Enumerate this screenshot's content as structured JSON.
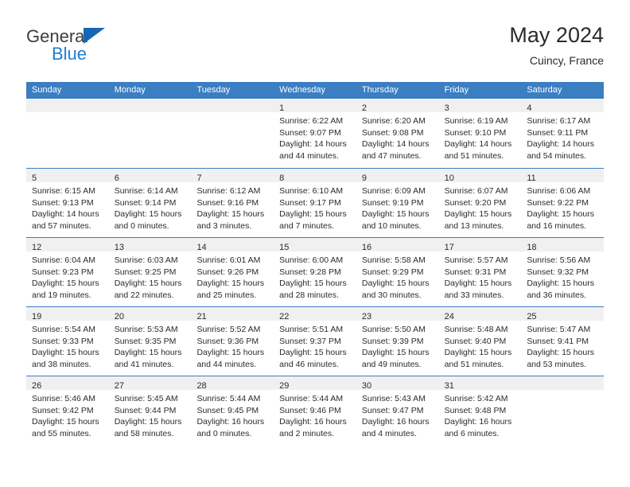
{
  "brand": {
    "name_part1": "General",
    "name_part2": "Blue",
    "triangle_icon": "triangle-logo-icon",
    "colors": {
      "dark": "#3c3c3c",
      "blue": "#1a7fd4",
      "triangle": "#1567b3"
    }
  },
  "header": {
    "title": "May 2024",
    "subtitle": "Cuincy, France"
  },
  "colors": {
    "header_band": "#3b7ec1",
    "day_band": "#f0f0f0",
    "text": "#2b2b2b",
    "rule": "#3b7ec1"
  },
  "weekdays": [
    "Sunday",
    "Monday",
    "Tuesday",
    "Wednesday",
    "Thursday",
    "Friday",
    "Saturday"
  ],
  "weeks": [
    [
      {
        "day": "",
        "lines": []
      },
      {
        "day": "",
        "lines": []
      },
      {
        "day": "",
        "lines": []
      },
      {
        "day": "1",
        "lines": [
          "Sunrise: 6:22 AM",
          "Sunset: 9:07 PM",
          "Daylight: 14 hours",
          "and 44 minutes."
        ]
      },
      {
        "day": "2",
        "lines": [
          "Sunrise: 6:20 AM",
          "Sunset: 9:08 PM",
          "Daylight: 14 hours",
          "and 47 minutes."
        ]
      },
      {
        "day": "3",
        "lines": [
          "Sunrise: 6:19 AM",
          "Sunset: 9:10 PM",
          "Daylight: 14 hours",
          "and 51 minutes."
        ]
      },
      {
        "day": "4",
        "lines": [
          "Sunrise: 6:17 AM",
          "Sunset: 9:11 PM",
          "Daylight: 14 hours",
          "and 54 minutes."
        ]
      }
    ],
    [
      {
        "day": "5",
        "lines": [
          "Sunrise: 6:15 AM",
          "Sunset: 9:13 PM",
          "Daylight: 14 hours",
          "and 57 minutes."
        ]
      },
      {
        "day": "6",
        "lines": [
          "Sunrise: 6:14 AM",
          "Sunset: 9:14 PM",
          "Daylight: 15 hours",
          "and 0 minutes."
        ]
      },
      {
        "day": "7",
        "lines": [
          "Sunrise: 6:12 AM",
          "Sunset: 9:16 PM",
          "Daylight: 15 hours",
          "and 3 minutes."
        ]
      },
      {
        "day": "8",
        "lines": [
          "Sunrise: 6:10 AM",
          "Sunset: 9:17 PM",
          "Daylight: 15 hours",
          "and 7 minutes."
        ]
      },
      {
        "day": "9",
        "lines": [
          "Sunrise: 6:09 AM",
          "Sunset: 9:19 PM",
          "Daylight: 15 hours",
          "and 10 minutes."
        ]
      },
      {
        "day": "10",
        "lines": [
          "Sunrise: 6:07 AM",
          "Sunset: 9:20 PM",
          "Daylight: 15 hours",
          "and 13 minutes."
        ]
      },
      {
        "day": "11",
        "lines": [
          "Sunrise: 6:06 AM",
          "Sunset: 9:22 PM",
          "Daylight: 15 hours",
          "and 16 minutes."
        ]
      }
    ],
    [
      {
        "day": "12",
        "lines": [
          "Sunrise: 6:04 AM",
          "Sunset: 9:23 PM",
          "Daylight: 15 hours",
          "and 19 minutes."
        ]
      },
      {
        "day": "13",
        "lines": [
          "Sunrise: 6:03 AM",
          "Sunset: 9:25 PM",
          "Daylight: 15 hours",
          "and 22 minutes."
        ]
      },
      {
        "day": "14",
        "lines": [
          "Sunrise: 6:01 AM",
          "Sunset: 9:26 PM",
          "Daylight: 15 hours",
          "and 25 minutes."
        ]
      },
      {
        "day": "15",
        "lines": [
          "Sunrise: 6:00 AM",
          "Sunset: 9:28 PM",
          "Daylight: 15 hours",
          "and 28 minutes."
        ]
      },
      {
        "day": "16",
        "lines": [
          "Sunrise: 5:58 AM",
          "Sunset: 9:29 PM",
          "Daylight: 15 hours",
          "and 30 minutes."
        ]
      },
      {
        "day": "17",
        "lines": [
          "Sunrise: 5:57 AM",
          "Sunset: 9:31 PM",
          "Daylight: 15 hours",
          "and 33 minutes."
        ]
      },
      {
        "day": "18",
        "lines": [
          "Sunrise: 5:56 AM",
          "Sunset: 9:32 PM",
          "Daylight: 15 hours",
          "and 36 minutes."
        ]
      }
    ],
    [
      {
        "day": "19",
        "lines": [
          "Sunrise: 5:54 AM",
          "Sunset: 9:33 PM",
          "Daylight: 15 hours",
          "and 38 minutes."
        ]
      },
      {
        "day": "20",
        "lines": [
          "Sunrise: 5:53 AM",
          "Sunset: 9:35 PM",
          "Daylight: 15 hours",
          "and 41 minutes."
        ]
      },
      {
        "day": "21",
        "lines": [
          "Sunrise: 5:52 AM",
          "Sunset: 9:36 PM",
          "Daylight: 15 hours",
          "and 44 minutes."
        ]
      },
      {
        "day": "22",
        "lines": [
          "Sunrise: 5:51 AM",
          "Sunset: 9:37 PM",
          "Daylight: 15 hours",
          "and 46 minutes."
        ]
      },
      {
        "day": "23",
        "lines": [
          "Sunrise: 5:50 AM",
          "Sunset: 9:39 PM",
          "Daylight: 15 hours",
          "and 49 minutes."
        ]
      },
      {
        "day": "24",
        "lines": [
          "Sunrise: 5:48 AM",
          "Sunset: 9:40 PM",
          "Daylight: 15 hours",
          "and 51 minutes."
        ]
      },
      {
        "day": "25",
        "lines": [
          "Sunrise: 5:47 AM",
          "Sunset: 9:41 PM",
          "Daylight: 15 hours",
          "and 53 minutes."
        ]
      }
    ],
    [
      {
        "day": "26",
        "lines": [
          "Sunrise: 5:46 AM",
          "Sunset: 9:42 PM",
          "Daylight: 15 hours",
          "and 55 minutes."
        ]
      },
      {
        "day": "27",
        "lines": [
          "Sunrise: 5:45 AM",
          "Sunset: 9:44 PM",
          "Daylight: 15 hours",
          "and 58 minutes."
        ]
      },
      {
        "day": "28",
        "lines": [
          "Sunrise: 5:44 AM",
          "Sunset: 9:45 PM",
          "Daylight: 16 hours",
          "and 0 minutes."
        ]
      },
      {
        "day": "29",
        "lines": [
          "Sunrise: 5:44 AM",
          "Sunset: 9:46 PM",
          "Daylight: 16 hours",
          "and 2 minutes."
        ]
      },
      {
        "day": "30",
        "lines": [
          "Sunrise: 5:43 AM",
          "Sunset: 9:47 PM",
          "Daylight: 16 hours",
          "and 4 minutes."
        ]
      },
      {
        "day": "31",
        "lines": [
          "Sunrise: 5:42 AM",
          "Sunset: 9:48 PM",
          "Daylight: 16 hours",
          "and 6 minutes."
        ]
      },
      {
        "day": "",
        "lines": []
      }
    ]
  ]
}
